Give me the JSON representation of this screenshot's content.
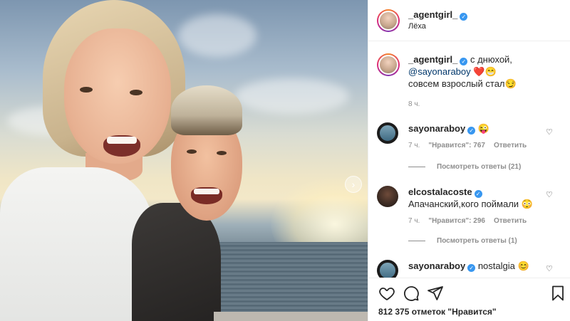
{
  "post": {
    "author": "_agentgirl_",
    "location": "Лёха",
    "caption": {
      "text_before": "с днюхой,",
      "mention": "@sayonaraboy",
      "emoji_after_mention": "❤️😁",
      "text_after": "совсем взрослый стал😏",
      "time": "8 ч."
    },
    "likes_text": "812 375 отметок \"Нравится\""
  },
  "comments": [
    {
      "username": "sayonaraboy",
      "text": "😜",
      "time": "7 ч.",
      "likes": "\"Нравится\": 767",
      "reply_label": "Ответить",
      "view_replies": "Посмотреть ответы (21)"
    },
    {
      "username": "elcostalacoste",
      "text": "Апачанский,кого поймали 😳",
      "time": "7 ч.",
      "likes": "\"Нравится\": 296",
      "reply_label": "Ответить",
      "view_replies": "Посмотреть ответы (1)"
    },
    {
      "username": "sayonaraboy",
      "text": "nostalgia 😊"
    }
  ],
  "icons": {
    "verified": "verified-badge-icon",
    "like": "heart-icon",
    "comment": "comment-bubble-icon",
    "share": "paper-plane-icon",
    "save": "bookmark-icon",
    "next": "chevron-right-icon"
  },
  "colors": {
    "verified": "#3897f0",
    "mention": "#00376b",
    "muted": "#8e8e8e",
    "heart": "#ed4956"
  }
}
